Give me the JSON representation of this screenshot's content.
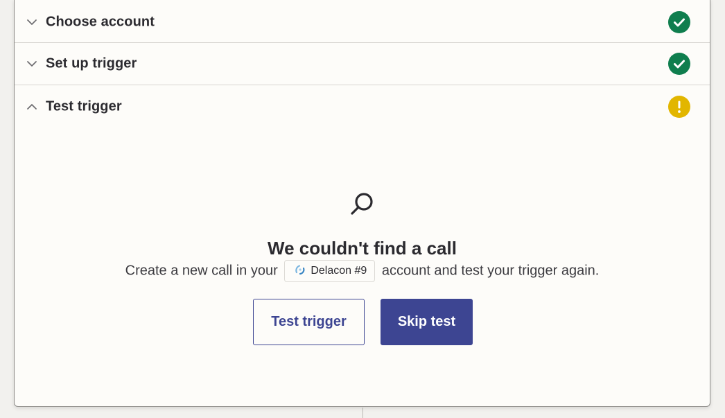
{
  "steps": [
    {
      "label": "Choose account",
      "state": "expanded-false",
      "status": "complete"
    },
    {
      "label": "Set up trigger",
      "state": "expanded-false",
      "status": "complete"
    },
    {
      "label": "Test trigger",
      "state": "expanded-true",
      "status": "warning"
    }
  ],
  "empty_state": {
    "icon": "search-icon",
    "title": "We couldn't find a call",
    "desc_before": "Create a new call in your",
    "account_chip": "Delacon #9",
    "desc_after": "account and test your trigger again."
  },
  "buttons": {
    "test_trigger": "Test trigger",
    "skip_test": "Skip test"
  },
  "colors": {
    "complete": "#0f7e4e",
    "warning": "#e2b600",
    "primary": "#3d4592",
    "panel_bg": "#fdfcf9"
  }
}
